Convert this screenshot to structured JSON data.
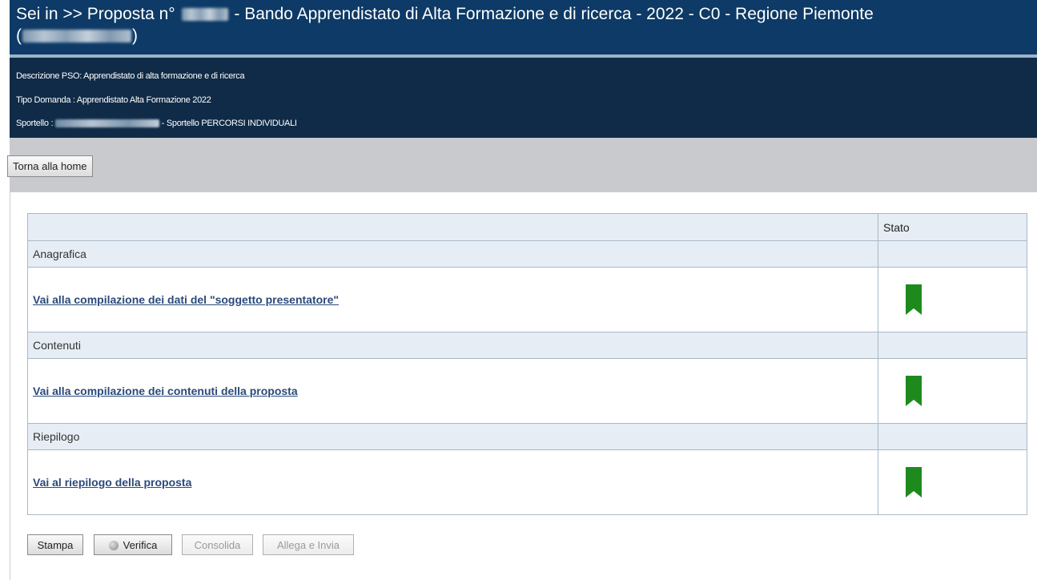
{
  "header": {
    "title_prefix": "Sei in >> Proposta n°",
    "title_main": "- Bando Apprendistato di Alta Formazione e di ricerca - 2022 - C0 - Regione Piemonte",
    "title_line2_open": "(",
    "title_line2_close": ")"
  },
  "info": {
    "descrizione": "Descrizione PSO: Apprendistato di alta formazione e di ricerca",
    "tipo_domanda": "Tipo Domanda : Apprendistato Alta Formazione 2022",
    "sportello_label": "Sportello :",
    "sportello_value": "- Sportello PERCORSI INDIVIDUALI"
  },
  "home_button": "Torna alla home",
  "table": {
    "stato_header": "Stato",
    "sections": [
      {
        "name": "Anagrafica",
        "link": "Vai alla compilazione dei dati del \"soggetto presentatore\"",
        "status_color": "#1e8a1e"
      },
      {
        "name": "Contenuti",
        "link": "Vai alla compilazione dei contenuti della proposta",
        "status_color": "#1e8a1e"
      },
      {
        "name": "Riepilogo",
        "link": "Vai al riepilogo della proposta",
        "status_color": "#1e8a1e"
      }
    ]
  },
  "actions": {
    "stampa": "Stampa",
    "verifica": "Verifica",
    "consolida": "Consolida",
    "allega_invia": "Allega e Invia"
  },
  "colors": {
    "header_bg": "#0d3a66",
    "info_bg": "#0f2b47",
    "status_green": "#1e8a1e"
  }
}
